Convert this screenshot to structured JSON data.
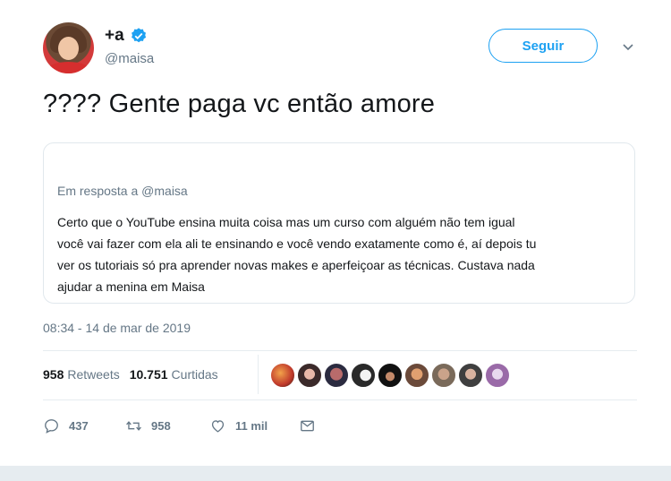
{
  "author": {
    "display_name": "+a",
    "handle": "@maisa"
  },
  "follow_button": {
    "label": "Seguir"
  },
  "tweet": {
    "text": "???? Gente paga vc então amore"
  },
  "quote": {
    "reply_prefix": "Em resposta a",
    "reply_mention": "@maisa",
    "lines": [
      "Certo que o YouTube ensina muita coisa mas um curso com alguém não tem igual",
      "você vai fazer com ela ali te ensinando e você vendo exatamente como é, aí depois tu",
      "ver os tutoriais só pra aprender novas makes e aperfeiçoar as técnicas. Custava nada",
      "ajudar a menina em Maisa"
    ]
  },
  "timestamp": "08:34 - 14 de mar de 2019",
  "stats": {
    "retweets_count": "958",
    "retweets_label": "Retweets",
    "likes_count": "10.751",
    "likes_label": "Curtidas"
  },
  "actions": {
    "replies": "437",
    "retweets": "958",
    "likes": "11 mil"
  },
  "colors": {
    "accent": "#1da1f2",
    "muted": "#657786",
    "text": "#14171a",
    "border": "#e1e8ed"
  },
  "icons": [
    "verified-badge-icon",
    "chevron-down-icon",
    "reply-icon",
    "retweet-icon",
    "heart-icon",
    "direct-message-icon"
  ]
}
